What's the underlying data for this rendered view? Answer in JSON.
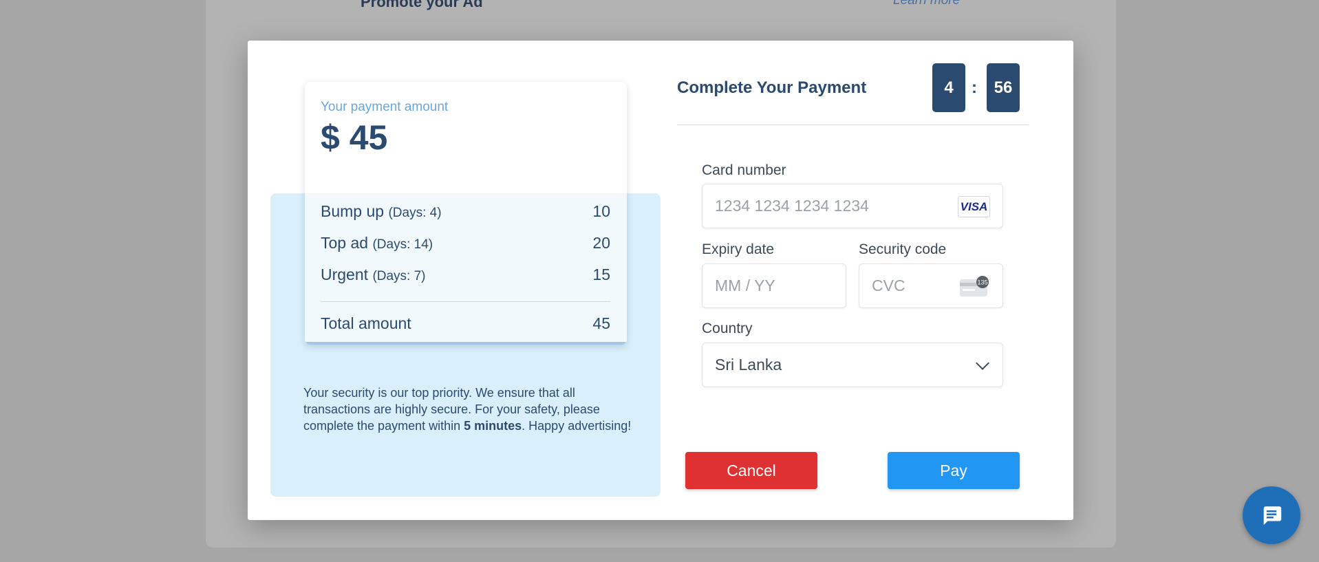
{
  "background": {
    "title": "Promote your Ad",
    "link": "Learn more"
  },
  "summary": {
    "amount_label": "Your payment amount",
    "amount_value": "$ 45",
    "items": [
      {
        "name": "Bump up",
        "days": "(Days: 4)",
        "price": "10"
      },
      {
        "name": "Top ad",
        "days": "(Days: 14)",
        "price": "20"
      },
      {
        "name": "Urgent",
        "days": "(Days: 7)",
        "price": "15"
      }
    ],
    "total_label": "Total amount",
    "total_value": "45",
    "security_text_before": "Your security is our top priority. We ensure that all transactions are highly secure. For your safety, please complete the payment within ",
    "security_text_bold": "5 minutes",
    "security_text_after": ". Happy advertising!"
  },
  "payment": {
    "title": "Complete Your Payment",
    "timer_minutes": "4",
    "timer_separator": ":",
    "timer_seconds": "56",
    "card_number_label": "Card number",
    "card_number_placeholder": "1234 1234 1234 1234",
    "card_brand": "VISA",
    "expiry_label": "Expiry date",
    "expiry_placeholder": "MM / YY",
    "security_label": "Security code",
    "security_placeholder": "CVC",
    "cvc_icon_text": "135",
    "country_label": "Country",
    "country_value": "Sri Lanka",
    "cancel_label": "Cancel",
    "pay_label": "Pay"
  },
  "colors": {
    "primary": "#2b4a6f",
    "cancel": "#df3131",
    "pay": "#2196f3",
    "panel": "#d9effb"
  },
  "icons": {
    "card_brand": "visa-icon",
    "cvc": "card-cvc-icon",
    "dropdown": "chevron-down-icon",
    "chat": "chat-icon"
  }
}
